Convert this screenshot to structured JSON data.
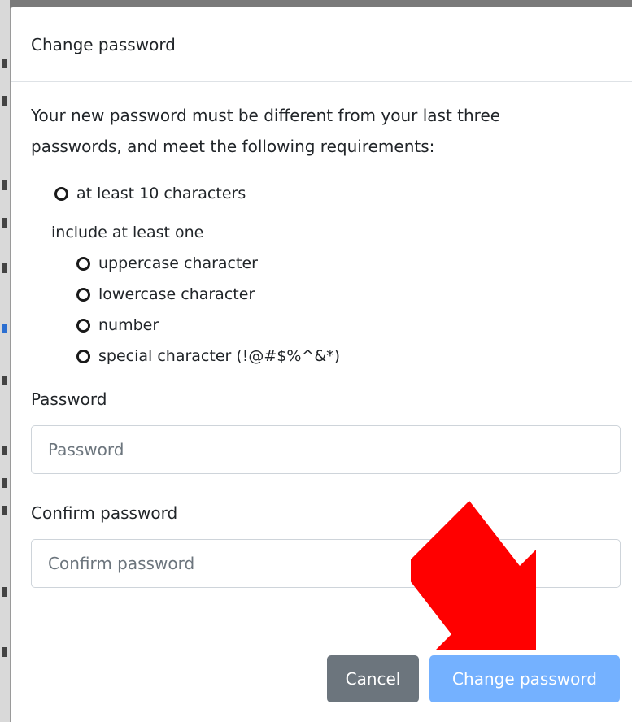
{
  "modal": {
    "title": "Change password",
    "intro": "Your new password must be different from your last three passwords, and meet the following requirements:",
    "requirements": {
      "length": "at least 10 characters",
      "group_label": "include at least one",
      "items": [
        "uppercase character",
        "lowercase character",
        "number",
        "special character (!@#$%^&*)"
      ]
    },
    "fields": {
      "password": {
        "label": "Password",
        "placeholder": "Password",
        "value": ""
      },
      "confirm": {
        "label": "Confirm password",
        "placeholder": "Confirm password",
        "value": ""
      }
    },
    "buttons": {
      "cancel": "Cancel",
      "submit": "Change password"
    }
  },
  "annotation": {
    "icon": "arrow-down-right-icon",
    "color": "#ff0000"
  },
  "colors": {
    "primary": "#74b1ff",
    "secondary": "#6c757d",
    "requirement_ring": "#1a1a1a"
  }
}
